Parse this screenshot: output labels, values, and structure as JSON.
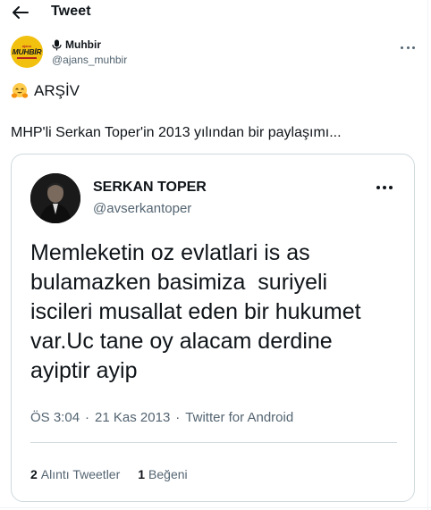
{
  "header": {
    "title": "Tweet"
  },
  "author": {
    "display_name": "Muhbir",
    "handle": "@ajans_muhbir",
    "avatar_small": "ajans",
    "avatar_main": "MUHBİR"
  },
  "tweet": {
    "archive_label": "ARŞİV",
    "text": "MHP'li Serkan Toper'in 2013 yılından bir paylaşımı..."
  },
  "quote": {
    "display_name": "SERKAN TOPER",
    "handle": "@avserkantoper",
    "lines": [
      "Memleketin oz evlatlari is as",
      "bulamazken basimiza  suriyeli",
      "iscileri musallat eden bir hukumet",
      "var.Uc tane oy alacam derdine",
      "ayiptir ayip"
    ],
    "time": "ÖS 3:04",
    "date": "21 Kas 2013",
    "source": "Twitter for Android",
    "separator": "·",
    "quote_tweets_count": "2",
    "quote_tweets_label": "Alıntı Tweetler",
    "likes_count": "1",
    "likes_label": "Beğeni"
  },
  "icons": {
    "back": "arrow-left-icon",
    "more": "ellipsis-icon",
    "mic": "microphone-icon",
    "hug": "hugging-face-emoji"
  },
  "colors": {
    "text": "#0f1419",
    "muted": "#536471",
    "border": "#cfd9de",
    "avatar_bg": "#f2c00f"
  }
}
